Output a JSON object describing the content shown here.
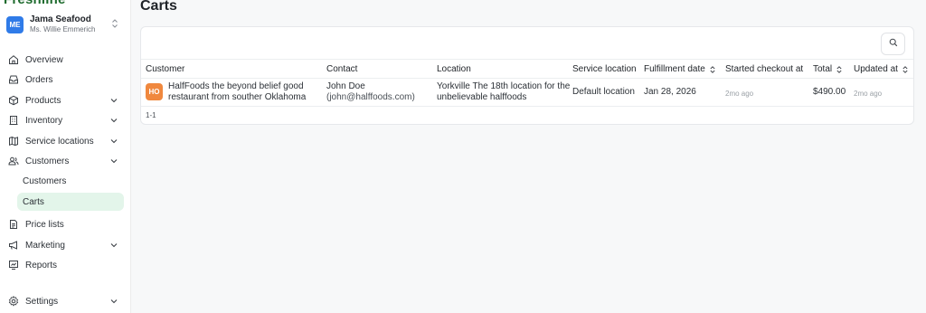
{
  "brand": "Freshline",
  "org": {
    "initials": "ME",
    "name": "Jama Seafood",
    "user": "Ms. Willie Emmerich"
  },
  "nav": {
    "overview": "Overview",
    "orders": "Orders",
    "products": "Products",
    "inventory": "Inventory",
    "service_locations": "Service locations",
    "customers": "Customers",
    "customers_sub": "Customers",
    "carts_sub": "Carts",
    "price_lists": "Price lists",
    "marketing": "Marketing",
    "reports": "Reports",
    "settings": "Settings"
  },
  "page": {
    "title": "Carts"
  },
  "table": {
    "headers": {
      "customer": "Customer",
      "contact": "Contact",
      "location": "Location",
      "service_location": "Service location",
      "fulfillment_date": "Fulfillment date",
      "started_checkout_at": "Started checkout at",
      "total": "Total",
      "updated_at": "Updated at"
    },
    "rows": [
      {
        "initials": "HO",
        "customer_line1": "HalfFoods the beyond belief good",
        "customer_line2": "restaurant from souther Oklahoma",
        "contact_name": "John Doe",
        "contact_email": "(john@halffoods.com)",
        "location_line1": "Yorkville The 18th location for the",
        "location_line2": "unbelievable halffoods",
        "service_location": "Default location",
        "fulfillment_date": "Jan 28, 2026",
        "started_checkout_at": "2mo ago",
        "total": "$490.00",
        "updated_at": "2mo ago"
      }
    ],
    "pagination": "1-1"
  },
  "colors": {
    "accent": "#e3f5ea",
    "brand": "#1e6b2e",
    "org_badge": "#2f7be8",
    "avatar": "#f0883e"
  }
}
